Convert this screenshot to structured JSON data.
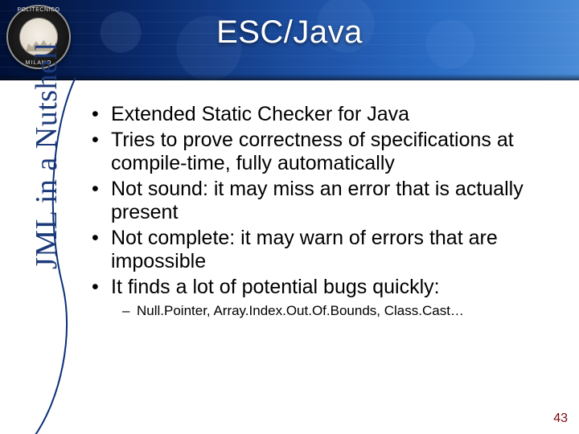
{
  "logo": {
    "top_text": "POLITECNICO",
    "bottom_text": "MILANO"
  },
  "title": "ESC/Java",
  "sidebar_label": "JML in a Nutshell",
  "bullets": [
    "Extended Static Checker for Java",
    "Tries to prove correctness of specifications at compile-time, fully automatically",
    "Not sound: it may miss an error that is actually present",
    "Not complete: it may warn of errors that are impossible",
    "It finds a lot of potential bugs quickly:"
  ],
  "sub_bullets": [
    "Null.Pointer, Array.Index.Out.Of.Bounds, Class.Cast…"
  ],
  "page_number": "43"
}
